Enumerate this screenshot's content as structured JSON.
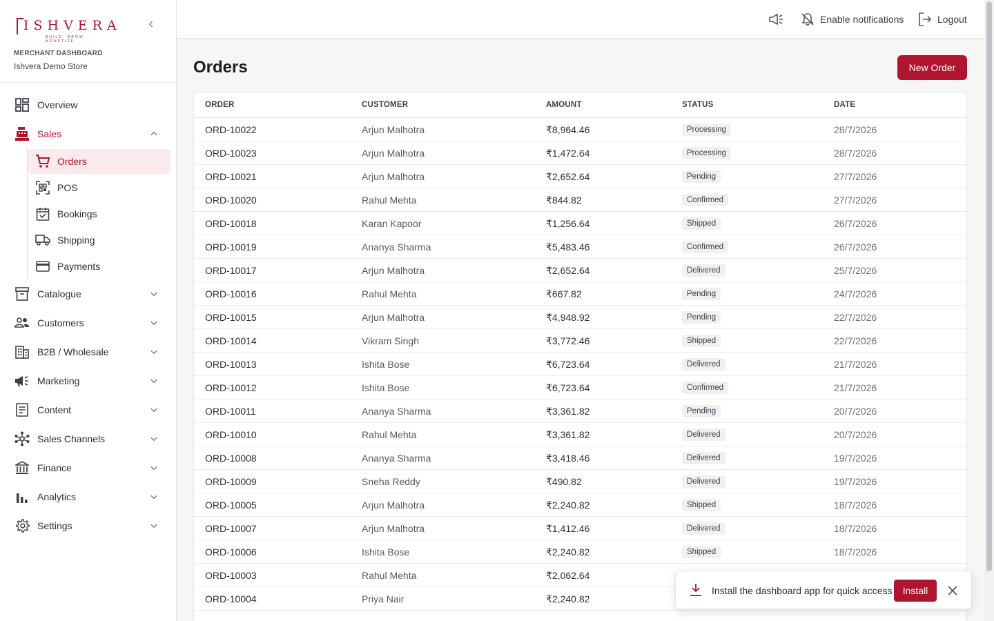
{
  "brand": {
    "name": "ISHVERA",
    "tagline": "BUILD. GROW. MONETIZE."
  },
  "merchant": {
    "label": "MERCHANT DASHBOARD",
    "store": "Ishvera Demo Store"
  },
  "nav": {
    "overview": "Overview",
    "sales": "Sales",
    "sales_sub": [
      "Orders",
      "POS",
      "Bookings",
      "Shipping",
      "Payments"
    ],
    "catalogue": "Catalogue",
    "customers": "Customers",
    "b2b": "B2B / Wholesale",
    "marketing": "Marketing",
    "content": "Content",
    "sales_channels": "Sales Channels",
    "finance": "Finance",
    "analytics": "Analytics",
    "settings": "Settings"
  },
  "topbar": {
    "notifications": "Enable notifications",
    "logout": "Logout"
  },
  "page": {
    "title": "Orders",
    "new_order": "New Order"
  },
  "table": {
    "headers": [
      "ORDER",
      "CUSTOMER",
      "AMOUNT",
      "STATUS",
      "DATE"
    ],
    "rows": [
      {
        "order": "ORD-10022",
        "customer": "Arjun Malhotra",
        "amount": "₹8,964.46",
        "status": "Processing",
        "date": "28/7/2026"
      },
      {
        "order": "ORD-10023",
        "customer": "Arjun Malhotra",
        "amount": "₹1,472.64",
        "status": "Processing",
        "date": "28/7/2026"
      },
      {
        "order": "ORD-10021",
        "customer": "Arjun Malhotra",
        "amount": "₹2,652.64",
        "status": "Pending",
        "date": "27/7/2026"
      },
      {
        "order": "ORD-10020",
        "customer": "Rahul Mehta",
        "amount": "₹844.82",
        "status": "Confirmed",
        "date": "27/7/2026"
      },
      {
        "order": "ORD-10018",
        "customer": "Karan Kapoor",
        "amount": "₹1,256.64",
        "status": "Shipped",
        "date": "26/7/2026"
      },
      {
        "order": "ORD-10019",
        "customer": "Ananya Sharma",
        "amount": "₹5,483.46",
        "status": "Confirmed",
        "date": "26/7/2026"
      },
      {
        "order": "ORD-10017",
        "customer": "Arjun Malhotra",
        "amount": "₹2,652.64",
        "status": "Delivered",
        "date": "25/7/2026"
      },
      {
        "order": "ORD-10016",
        "customer": "Rahul Mehta",
        "amount": "₹667.82",
        "status": "Pending",
        "date": "24/7/2026"
      },
      {
        "order": "ORD-10015",
        "customer": "Arjun Malhotra",
        "amount": "₹4,948.92",
        "status": "Pending",
        "date": "22/7/2026"
      },
      {
        "order": "ORD-10014",
        "customer": "Vikram Singh",
        "amount": "₹3,772.46",
        "status": "Shipped",
        "date": "22/7/2026"
      },
      {
        "order": "ORD-10013",
        "customer": "Ishita Bose",
        "amount": "₹6,723.64",
        "status": "Delivered",
        "date": "21/7/2026"
      },
      {
        "order": "ORD-10012",
        "customer": "Ishita Bose",
        "amount": "₹6,723.64",
        "status": "Confirmed",
        "date": "21/7/2026"
      },
      {
        "order": "ORD-10011",
        "customer": "Ananya Sharma",
        "amount": "₹3,361.82",
        "status": "Pending",
        "date": "20/7/2026"
      },
      {
        "order": "ORD-10010",
        "customer": "Rahul Mehta",
        "amount": "₹3,361.82",
        "status": "Delivered",
        "date": "20/7/2026"
      },
      {
        "order": "ORD-10008",
        "customer": "Ananya Sharma",
        "amount": "₹3,418.46",
        "status": "Delivered",
        "date": "19/7/2026"
      },
      {
        "order": "ORD-10009",
        "customer": "Sneha Reddy",
        "amount": "₹490.82",
        "status": "Delivered",
        "date": "19/7/2026"
      },
      {
        "order": "ORD-10005",
        "customer": "Arjun Malhotra",
        "amount": "₹2,240.82",
        "status": "Shipped",
        "date": "18/7/2026"
      },
      {
        "order": "ORD-10007",
        "customer": "Arjun Malhotra",
        "amount": "₹1,412.46",
        "status": "Delivered",
        "date": "18/7/2026"
      },
      {
        "order": "ORD-10006",
        "customer": "Ishita Bose",
        "amount": "₹2,240.82",
        "status": "Shipped",
        "date": "18/7/2026"
      },
      {
        "order": "ORD-10003",
        "customer": "Rahul Mehta",
        "amount": "₹2,062.64",
        "status": "",
        "date": ""
      },
      {
        "order": "ORD-10004",
        "customer": "Priya Nair",
        "amount": "₹2,240.82",
        "status": "",
        "date": ""
      }
    ]
  },
  "toast": {
    "message": "Install the dashboard app for quick access",
    "install": "Install"
  },
  "colors": {
    "accent": "#b0152f",
    "accent_bg": "#fbe9ec",
    "badge_bg": "#f0f0f2"
  },
  "icons": [
    "chevron-left-icon",
    "dashboard-grid-icon",
    "cash-register-icon",
    "cart-icon",
    "qr-code-icon",
    "calendar-check-icon",
    "truck-icon",
    "credit-card-icon",
    "archive-box-icon",
    "people-icon",
    "building-icon",
    "megaphone-icon",
    "document-icon",
    "hub-icon",
    "bank-icon",
    "bar-chart-icon",
    "gear-icon",
    "bell-off-icon",
    "logout-icon",
    "download-icon",
    "close-icon"
  ]
}
